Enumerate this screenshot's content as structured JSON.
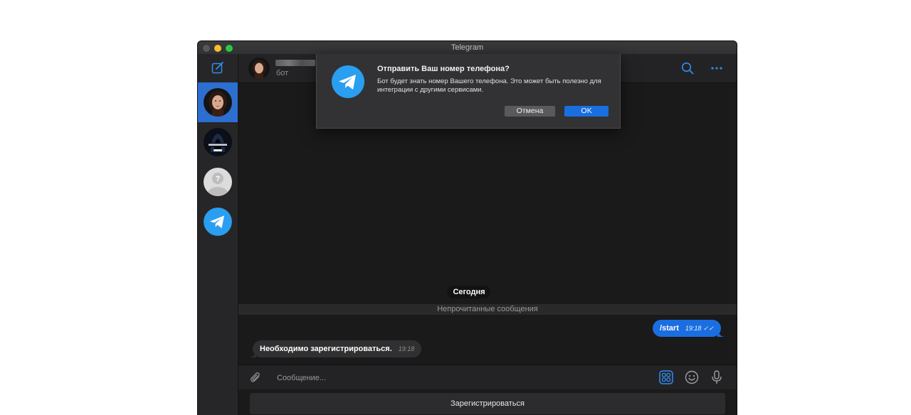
{
  "window": {
    "title": "Telegram"
  },
  "sidebar": {
    "compose_icon": "compose-icon",
    "chats": [
      {
        "avatar": "woman-portrait-avatar",
        "active": true
      },
      {
        "avatar": "hooded-figure-avatar",
        "active": false
      },
      {
        "avatar": "unknown-user-avatar",
        "active": false
      },
      {
        "avatar": "telegram-logo-avatar",
        "active": false
      }
    ]
  },
  "header": {
    "status": "бот",
    "search_icon": "search-icon",
    "more_icon": "more-icon"
  },
  "messages": {
    "date_separator": "Сегодня",
    "unread_separator": "Непрочитанные сообщения",
    "outgoing": {
      "text": "/start",
      "time": "19:18"
    },
    "incoming": {
      "text": "Необходимо зарегистрироваться.",
      "time": "19:18"
    }
  },
  "composer": {
    "placeholder": "Сообщение...",
    "bot_keyboard_button": "Зарегистрироваться"
  },
  "dialog": {
    "title": "Отправить Ваш номер телефона?",
    "body": "Бот будет знать номер Вашего телефона. Это может быть полезно для интеграции с другими сервисами.",
    "cancel_label": "Отмена",
    "ok_label": "OK"
  },
  "colors": {
    "accent": "#1a6ee0",
    "selected_chat": "#2d6ed1",
    "background": "#1a1a1a"
  }
}
